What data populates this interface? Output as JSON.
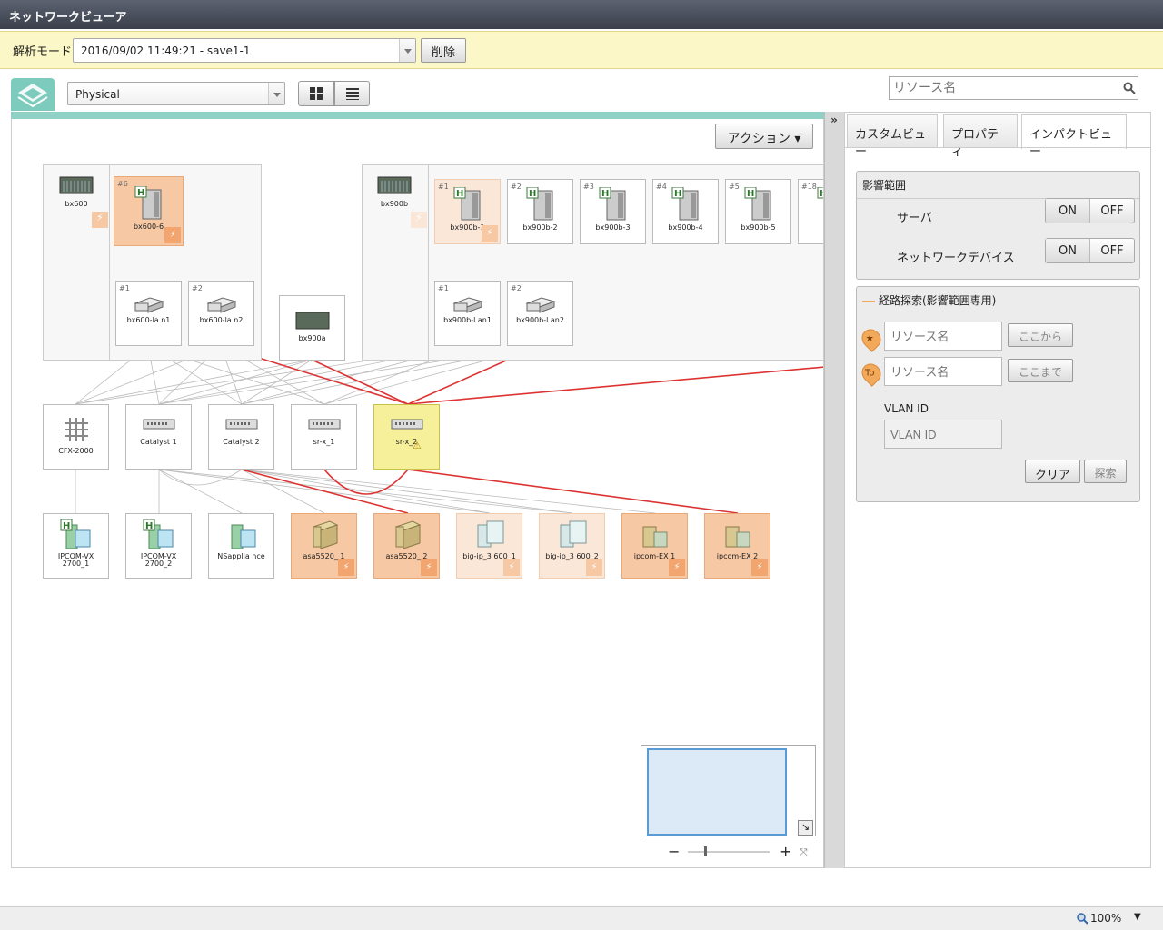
{
  "window": {
    "title": "ネットワークビューア"
  },
  "mode_bar": {
    "label": "解析モード",
    "selected": "2016/09/02 11:49:21 - save1-1",
    "delete_label": "削除"
  },
  "toolbar": {
    "view_selected": "Physical",
    "search_placeholder": "リソース名"
  },
  "canvas": {
    "action_label": "アクション"
  },
  "chassis": [
    {
      "name": "bx600",
      "slots": [
        {
          "name": "bx600-6",
          "slot": "#6",
          "state": "impacted"
        }
      ],
      "lans": [
        {
          "name": "bx600-la n1",
          "slot": "#1"
        },
        {
          "name": "bx600-la n2",
          "slot": "#2"
        }
      ]
    },
    {
      "name": "bx900b",
      "slots": [
        {
          "name": "bx900b-1",
          "slot": "#1",
          "state": "impacted-light"
        },
        {
          "name": "bx900b-2",
          "slot": "#2",
          "state": "normal"
        },
        {
          "name": "bx900b-3",
          "slot": "#3",
          "state": "normal"
        },
        {
          "name": "bx900b-4",
          "slot": "#4",
          "state": "normal"
        },
        {
          "name": "bx900b-5",
          "slot": "#5",
          "state": "normal"
        },
        {
          "name": "bx",
          "slot": "#18",
          "state": "normal"
        }
      ],
      "lans": [
        {
          "name": "bx900b-l an1",
          "slot": "#1"
        },
        {
          "name": "bx900b-l an2",
          "slot": "#2"
        }
      ]
    }
  ],
  "standalone": [
    {
      "name": "bx900a"
    }
  ],
  "switches": [
    {
      "name": "CFX-2000",
      "state": "normal"
    },
    {
      "name": "Catalyst 1",
      "state": "normal"
    },
    {
      "name": "Catalyst 2",
      "state": "normal"
    },
    {
      "name": "sr-x_1",
      "state": "normal"
    },
    {
      "name": "sr-x_2",
      "state": "warning"
    }
  ],
  "appliances": [
    {
      "name": "IPCOM-VX 2700_1",
      "state": "normal"
    },
    {
      "name": "IPCOM-VX 2700_2",
      "state": "normal"
    },
    {
      "name": "NSapplia nce",
      "state": "normal"
    },
    {
      "name": "asa5520_ 1",
      "state": "impacted"
    },
    {
      "name": "asa5520_ 2",
      "state": "impacted"
    },
    {
      "name": "big-ip_3 600_1",
      "state": "impacted-light"
    },
    {
      "name": "big-ip_3 600_2",
      "state": "impacted-light"
    },
    {
      "name": "ipcom-EX 1",
      "state": "impacted"
    },
    {
      "name": "ipcom-EX 2",
      "state": "impacted"
    }
  ],
  "right_panel": {
    "tabs": [
      {
        "label": "カスタムビュー"
      },
      {
        "label": "プロパティ"
      },
      {
        "label": "インパクトビュー"
      }
    ],
    "impact_group": {
      "title": "影響範囲",
      "server_label": "サーバ",
      "network_label": "ネットワークデバイス",
      "on": "ON",
      "off": "OFF"
    },
    "route_group": {
      "title": "経路探索(影響範囲専用)",
      "from_placeholder": "リソース名",
      "from_btn": "ここから",
      "to_placeholder": "リソース名",
      "to_btn": "ここまで",
      "to_badge": "To",
      "vlan_label": "VLAN ID",
      "vlan_placeholder": "VLAN ID",
      "clear_btn": "クリア",
      "search_btn": "探索"
    }
  },
  "colors": {
    "impact": "#f6c8a4",
    "impact_light": "#fbe7d8",
    "warning": "#f6f09a",
    "link_red": "#dd3333",
    "teal": "#8fd1c5"
  },
  "status": {
    "zoom": "100%"
  }
}
